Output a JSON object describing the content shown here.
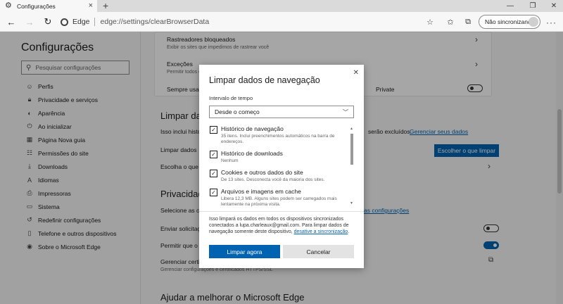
{
  "tab": {
    "title": "Configurações"
  },
  "address": {
    "site_label": "Edge",
    "url": "edge://settings/clearBrowserData"
  },
  "profile": {
    "sync_label": "Não sincronizando"
  },
  "sidebar": {
    "title": "Configurações",
    "search_placeholder": "Pesquisar configurações",
    "items": [
      {
        "label": "Perfis",
        "icon": "profile-icon"
      },
      {
        "label": "Privacidade e serviços",
        "icon": "lock-icon"
      },
      {
        "label": "Aparência",
        "icon": "palette-icon"
      },
      {
        "label": "Ao inicializar",
        "icon": "power-icon"
      },
      {
        "label": "Página Nova guia",
        "icon": "newtab-icon"
      },
      {
        "label": "Permissões do site",
        "icon": "permissions-icon"
      },
      {
        "label": "Downloads",
        "icon": "download-icon"
      },
      {
        "label": "Idiomas",
        "icon": "language-icon"
      },
      {
        "label": "Impressoras",
        "icon": "printer-icon"
      },
      {
        "label": "Sistema",
        "icon": "system-icon"
      },
      {
        "label": "Redefinir configurações",
        "icon": "reset-icon"
      },
      {
        "label": "Telefone e outros dispositivos",
        "icon": "phone-icon"
      },
      {
        "label": "Sobre o Microsoft Edge",
        "icon": "edge-icon"
      }
    ]
  },
  "main": {
    "tracker_title": "Rastreadores bloqueados",
    "tracker_sub": "Exibir os sites que impedimos de rastrear você",
    "exceptions_title": "Exceções",
    "exceptions_sub": "Permitir todos os",
    "always_use": "Sempre usar",
    "always_use_tail": "Private",
    "clear_heading": "Limpar dad",
    "clear_desc": "Isso inclui histó",
    "clear_desc_tail": "serão excluídos.",
    "manage_link": "Gerenciar seus dados",
    "clear_now_row": "Limpar dados",
    "choose_button": "Escolher o que limpar",
    "choose_row": "Escolha o que",
    "privacy_heading": "Privacidad",
    "privacy_desc": "Selecione as co",
    "privacy_link": "as configurações",
    "send_requests": "Enviar solicitaç",
    "allow_sites": "Permitir que o",
    "manage_certs": "Gerenciar certi",
    "manage_certs_sub": "Gerenciar configurações e certificados HTTPS/SSL",
    "improve_heading": "Ajudar a melhorar o Microsoft Edge"
  },
  "modal": {
    "title": "Limpar dados de navegação",
    "time_range_label": "Intervalo de tempo",
    "time_range_value": "Desde o começo",
    "items": [
      {
        "title": "Histórico de navegação",
        "desc": "35 itens. Inclui preenchimentos automáticos na barra de endereços.",
        "checked": true
      },
      {
        "title": "Histórico de downloads",
        "desc": "Nenhum",
        "checked": true
      },
      {
        "title": "Cookies e outros dados do site",
        "desc": "De 13 sites. Desconecta você da maioria dos sites.",
        "checked": true
      },
      {
        "title": "Arquivos e imagens em cache",
        "desc": "Libera 12,3 MB. Alguns sites podem ser carregados mais lentamente na próxima visita.",
        "checked": true
      }
    ],
    "info_text": "Isso limpará os dados em todos os dispositivos sincronizados conectados a lupa.charleaux@gmail.com. Para limpar dados de navegação somente deste dispositivo,",
    "info_link": "desative a sincronização",
    "clear_button": "Limpar agora",
    "cancel_button": "Cancelar"
  },
  "colors": {
    "accent": "#0063b1",
    "overlay": "rgba(0,0,0,0.35)"
  }
}
